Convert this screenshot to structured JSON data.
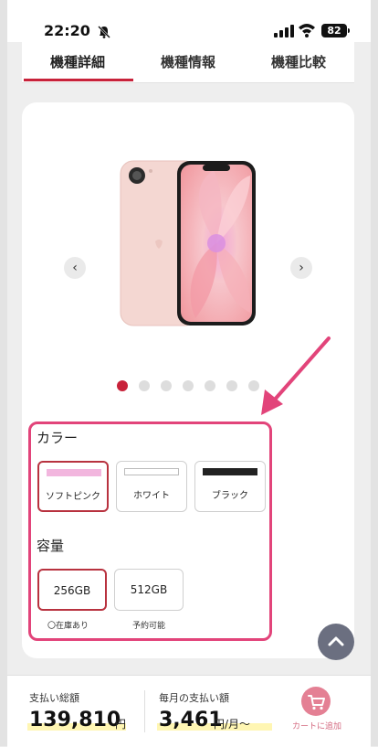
{
  "status": {
    "time": "22:20",
    "battery": "82"
  },
  "tabs": [
    {
      "label": "機種詳細"
    },
    {
      "label": "機種情報"
    },
    {
      "label": "機種比較"
    }
  ],
  "carousel": {
    "dot_count": 7,
    "active_index": 0
  },
  "color_section": {
    "title": "カラー",
    "options": [
      {
        "label": "ソフトピンク",
        "swatch": "#f2b6de",
        "selected": true
      },
      {
        "label": "ホワイト",
        "swatch": "#ffffff",
        "selected": false
      },
      {
        "label": "ブラック",
        "swatch": "#222222",
        "selected": false
      }
    ]
  },
  "capacity_section": {
    "title": "容量",
    "options": [
      {
        "label": "256GB",
        "stock": "〇在庫あり",
        "selected": true
      },
      {
        "label": "512GB",
        "stock": "予約可能",
        "selected": false
      }
    ]
  },
  "bottom": {
    "total_label": "支払い総額",
    "total_amount": "139,810",
    "total_unit": "円",
    "monthly_label": "毎月の支払い額",
    "monthly_amount": "3,461",
    "monthly_unit": "円/月〜",
    "cart_label": "カートに追加"
  },
  "colors": {
    "accent": "#c8223a",
    "annotation": "#e2447a",
    "cart": "#e48094"
  }
}
